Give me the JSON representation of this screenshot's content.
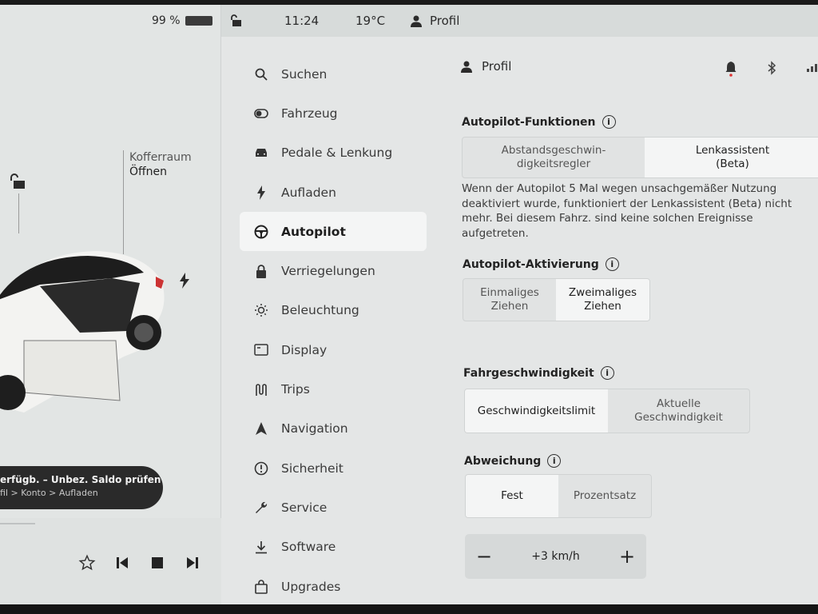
{
  "status_bar": {
    "battery": "99 %",
    "time": "11:24",
    "temperature": "19°C",
    "profile": "Profil"
  },
  "car_panel": {
    "trunk_label": "Kofferraum",
    "trunk_action": "Öffnen",
    "promo_line1": "erfügb. – Unbez. Saldo prüfen",
    "promo_line2": "fil > Konto > Aufladen"
  },
  "nav": {
    "items": [
      {
        "label": "Suchen",
        "icon": "search-icon"
      },
      {
        "label": "Fahrzeug",
        "icon": "toggle-icon"
      },
      {
        "label": "Pedale & Lenkung",
        "icon": "car-icon"
      },
      {
        "label": "Aufladen",
        "icon": "bolt-icon"
      },
      {
        "label": "Autopilot",
        "icon": "steering-wheel-icon",
        "active": true
      },
      {
        "label": "Verriegelungen",
        "icon": "lock-icon"
      },
      {
        "label": "Beleuchtung",
        "icon": "sun-icon"
      },
      {
        "label": "Display",
        "icon": "display-icon"
      },
      {
        "label": "Trips",
        "icon": "trips-icon"
      },
      {
        "label": "Navigation",
        "icon": "navigation-icon"
      },
      {
        "label": "Sicherheit",
        "icon": "alert-icon"
      },
      {
        "label": "Service",
        "icon": "wrench-icon"
      },
      {
        "label": "Software",
        "icon": "download-icon"
      },
      {
        "label": "Upgrades",
        "icon": "bag-icon"
      }
    ]
  },
  "content": {
    "profile_label": "Profil",
    "autopilot_features": {
      "title": "Autopilot-Funktionen",
      "options": [
        "Abstandsgeschwin-\ndigkeitsregler",
        "Lenkassistent\n(Beta)"
      ],
      "selected": 1
    },
    "description": "Wenn der Autopilot 5 Mal wegen unsachgemäßer Nutzung deaktiviert wurde, funktioniert der Lenkassistent (Beta) nicht mehr. Bei diesem Fahrz. sind keine solchen Ereignisse aufgetreten.",
    "activation": {
      "title": "Autopilot-Aktivierung",
      "options": [
        "Einmaliges\nZiehen",
        "Zweimaliges\nZiehen"
      ],
      "selected": 1
    },
    "speed": {
      "title": "Fahrgeschwindigkeit",
      "options": [
        "Geschwindigkeitslimit",
        "Aktuelle\nGeschwindigkeit"
      ],
      "selected": 0
    },
    "offset": {
      "title": "Abweichung",
      "options": [
        "Fest",
        "Prozentsatz"
      ],
      "selected": 0
    },
    "stepper": {
      "minus": "−",
      "value": "+3 km/h",
      "plus": "+"
    }
  },
  "colors": {
    "screen_bg": "#e4e6e6",
    "selected_bg": "#f4f5f5",
    "text": "#2b2b2b"
  }
}
